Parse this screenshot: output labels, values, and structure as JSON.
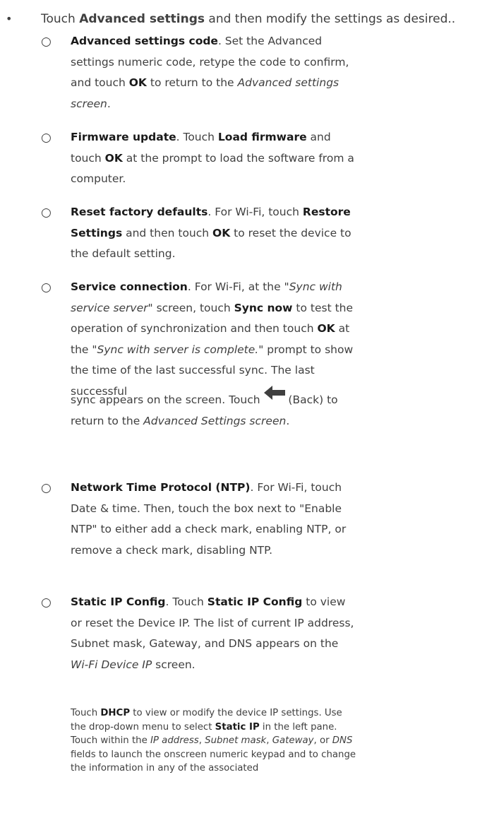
{
  "intro": {
    "bullet": "•",
    "prefix": "Touch ",
    "bold": "Advanced settings",
    "suffix": " and then modify the settings as desired.."
  },
  "marker": "○",
  "items": [
    {
      "title": "Advanced settings code",
      "t1": ". Set the Advanced settings numeric code, retype the code to confirm, and touch ",
      "b1": "OK",
      "t2": " to return to the ",
      "i1": "Advanced settings screen",
      "t3": "."
    },
    {
      "title": "Firmware update",
      "t1": ". Touch ",
      "b1": "Load firmware",
      "t2": " and touch ",
      "b2": "OK",
      "t3": " at the prompt to load the software from a computer."
    },
    {
      "title": "Reset factory defaults",
      "t1": ". For Wi-Fi, touch ",
      "b1": "Restore Settings",
      "t2": " and then touch ",
      "b2": "OK",
      "t3": " to reset the device to the default setting."
    },
    {
      "title": "Service connection",
      "t1": ". For Wi-Fi, at the \"",
      "i1": "Sync with service server",
      "t2": "\" screen, touch ",
      "b1": "Sync now",
      "t3": " to test the operation of synchronization and then touch ",
      "b2": "OK",
      "t4": " at the \"",
      "i2": "Sync with server is complete.",
      "t5": "\" prompt to show the time of the last successful sync. The last successful",
      "t6": "sync appears on the screen. Touch ",
      "t7": " (Back) to return to the ",
      "i3": "Advanced Settings screen",
      "t8": "."
    },
    {
      "title": "Network Time Protocol (NTP)",
      "t1": ". For Wi-Fi, touch Date & time. Then, touch the box next to \"Enable NTP\" to either add a check mark, enabling NTP, or remove a check mark, disabling NTP."
    },
    {
      "title": "Static IP Config",
      "t1": ". Touch ",
      "b1": "Static IP Config",
      "t2": " to view or reset the Device IP. The list of current IP address, Subnet mask, Gateway, and DNS appears on the ",
      "i1": "Wi-Fi Device IP",
      "t3": " screen."
    }
  ],
  "dhcp": {
    "t1": "Touch ",
    "b1": "DHCP",
    "t2": " to view or modify the device IP settings. Use the drop-down menu to select ",
    "b2": "Static IP",
    "t3": " in the left pane. Touch within the ",
    "i1": "IP address",
    "t4": ", ",
    "i2": "Subnet mask",
    "t5": ", ",
    "i3": "Gateway",
    "t6": ", or ",
    "i4": "DNS",
    "t7": " fields to launch the onscreen numeric keypad and to change the information in any of the associated"
  },
  "colors": {
    "text": "#404040",
    "emphasis": "#1a1a1a",
    "icon": "#3f3f3f"
  },
  "icons": {
    "back": "back-arrow-icon"
  }
}
